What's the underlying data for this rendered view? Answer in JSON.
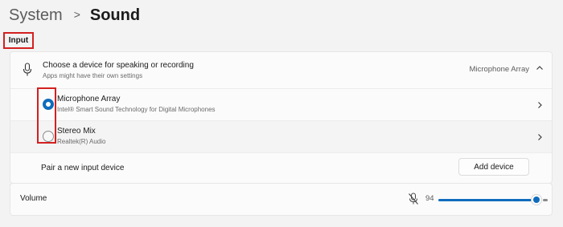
{
  "breadcrumb": {
    "parent": "System",
    "separator": ">",
    "current": "Sound"
  },
  "section": {
    "label": "Input"
  },
  "input": {
    "title": "Choose a device for speaking or recording",
    "subtitle": "Apps might have their own settings",
    "selected_value": "Microphone Array",
    "devices": [
      {
        "name": "Microphone Array",
        "description": "Intel® Smart Sound Technology for Digital Microphones",
        "selected": true
      },
      {
        "name": "Stereo Mix",
        "description": "Realtek(R) Audio",
        "selected": false
      }
    ],
    "pair_label": "Pair a new input device",
    "add_button": "Add device"
  },
  "volume": {
    "label": "Volume",
    "value": "94",
    "level": 0.94
  },
  "colors": {
    "accent": "#0f6cbd",
    "highlight": "#d32020",
    "background": "#f3f3f3",
    "card": "#fbfbfb"
  },
  "icons": [
    "microphone-icon",
    "chevron-up-icon",
    "chevron-right-icon",
    "microphone-muted-icon"
  ]
}
